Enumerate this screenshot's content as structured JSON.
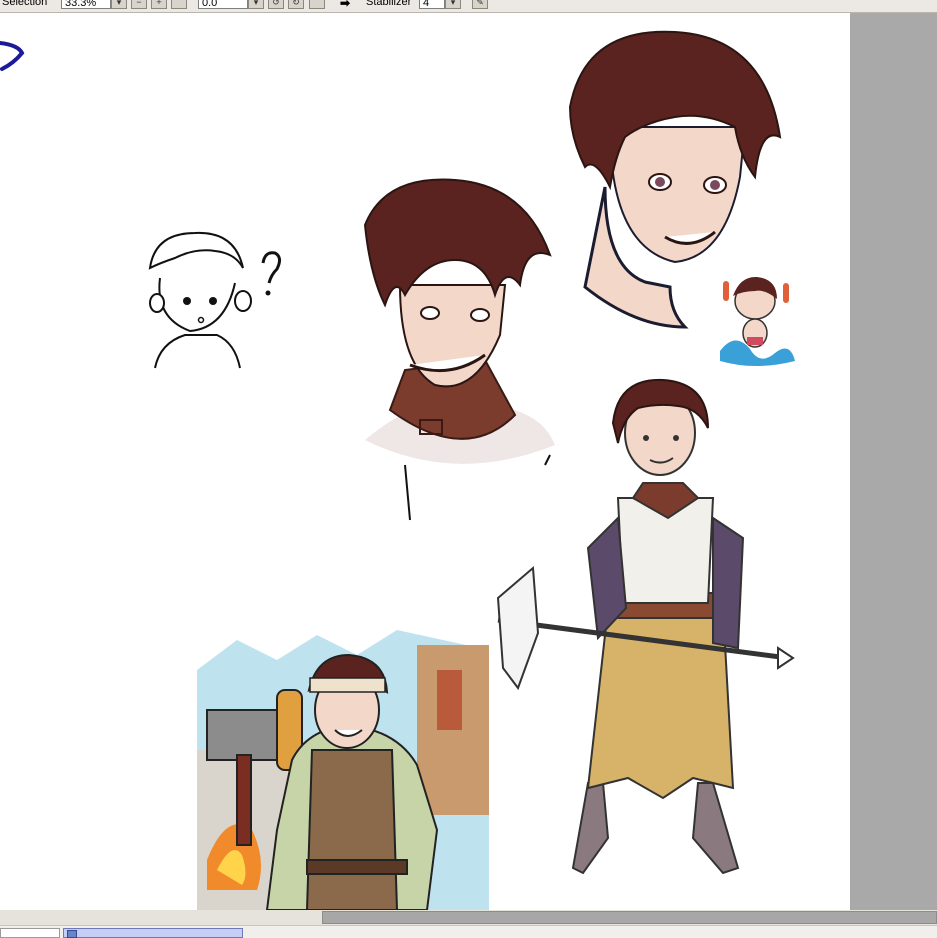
{
  "toolbar": {
    "selection_label": "Selection",
    "zoom_value": "33.3%",
    "angle_value": "0.0",
    "stabilizer_label": "Stabilizer",
    "stabilizer_value": "4"
  },
  "colors": {
    "hair": "#5a2320",
    "skin": "#f3d7c8",
    "collar": "#7b3b2d",
    "pasteboard": "#a9a9a9",
    "toolbar": "#ece9e4",
    "tab_active": "#c6cef3"
  },
  "icons": [
    "chevron-down-icon",
    "zoom-out-icon",
    "zoom-in-icon",
    "rotate-left-icon",
    "rotate-right-icon",
    "arrow-right-icon",
    "brush-icon",
    "document-icon"
  ]
}
